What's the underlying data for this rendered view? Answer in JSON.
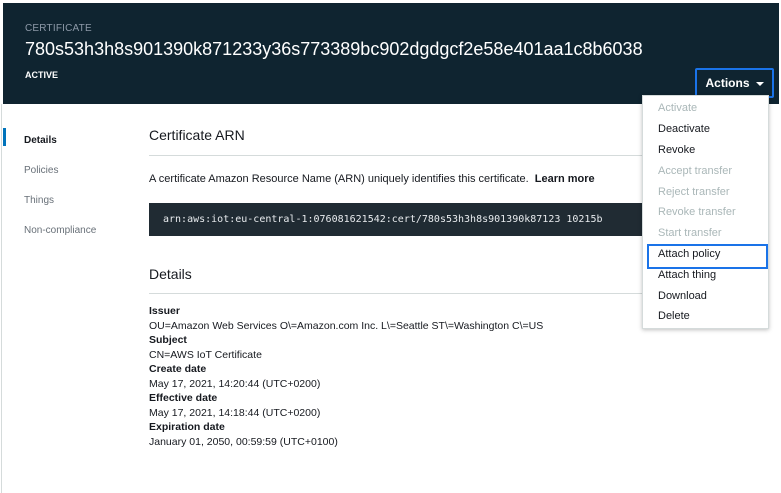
{
  "header": {
    "label": "CERTIFICATE",
    "certificate_id": "780s53h3h8s901390k871233y36s773389bc902dgdgcf2e58e401aa1c8b6038",
    "status": "ACTIVE",
    "actions_label": "Actions"
  },
  "nav": {
    "items": [
      {
        "label": "Details",
        "active": true
      },
      {
        "label": "Policies",
        "active": false
      },
      {
        "label": "Things",
        "active": false
      },
      {
        "label": "Non-compliance",
        "active": false
      }
    ]
  },
  "arn_section": {
    "title": "Certificate ARN",
    "description": "A certificate Amazon Resource Name (ARN) uniquely identifies this certificate.",
    "learn_more": "Learn more",
    "arn": "arn:aws:iot:eu-central-1:076081621542:cert/780s53h3h8s901390k87123 10215b"
  },
  "details_section": {
    "title": "Details",
    "fields": [
      {
        "label": "Issuer",
        "value": "OU=Amazon Web Services O\\=Amazon.com Inc. L\\=Seattle ST\\=Washington C\\=US"
      },
      {
        "label": "Subject",
        "value": "CN=AWS IoT Certificate"
      },
      {
        "label": "Create date",
        "value": "May 17, 2021, 14:20:44 (UTC+0200)"
      },
      {
        "label": "Effective date",
        "value": "May 17, 2021, 14:18:44 (UTC+0200)"
      },
      {
        "label": "Expiration date",
        "value": "January 01, 2050, 00:59:59 (UTC+0100)"
      }
    ]
  },
  "actions_menu": {
    "items": [
      {
        "label": "Activate",
        "enabled": false
      },
      {
        "label": "Deactivate",
        "enabled": true
      },
      {
        "label": "Revoke",
        "enabled": true
      },
      {
        "label": "Accept transfer",
        "enabled": false
      },
      {
        "label": "Reject transfer",
        "enabled": false
      },
      {
        "label": "Revoke transfer",
        "enabled": false
      },
      {
        "label": "Start transfer",
        "enabled": false
      },
      {
        "label": "Attach policy",
        "enabled": true,
        "focused": true
      },
      {
        "label": "Attach thing",
        "enabled": true
      },
      {
        "label": "Download",
        "enabled": true
      },
      {
        "label": "Delete",
        "enabled": true
      }
    ]
  },
  "colors": {
    "header_bg": "#0f2430",
    "focus_ring": "#1a73e8",
    "nav_active_bar": "#0073bb",
    "arn_box_bg": "#202b33",
    "disabled_text": "#aab7b8"
  }
}
